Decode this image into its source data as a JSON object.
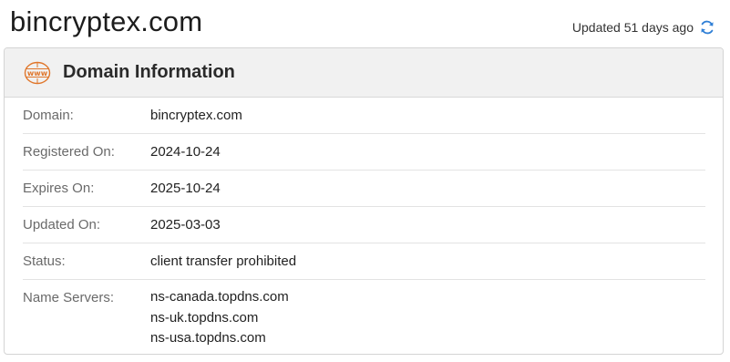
{
  "header": {
    "domain": "bincryptex.com",
    "updated_text": "Updated 51 days ago",
    "refresh_icon": "refresh-icon",
    "accent_color": "#2f7fd6"
  },
  "card": {
    "icon": "www-icon",
    "icon_text": "www",
    "icon_color": "#e0762b",
    "title": "Domain Information",
    "rows": [
      {
        "label": "Domain:",
        "value": "bincryptex.com"
      },
      {
        "label": "Registered On:",
        "value": "2024-10-24"
      },
      {
        "label": "Expires On:",
        "value": "2025-10-24"
      },
      {
        "label": "Updated On:",
        "value": "2025-03-03"
      },
      {
        "label": "Status:",
        "value": "client transfer prohibited"
      }
    ],
    "name_servers": {
      "label": "Name Servers:",
      "values": [
        "ns-canada.topdns.com",
        "ns-uk.topdns.com",
        "ns-usa.topdns.com"
      ]
    }
  }
}
